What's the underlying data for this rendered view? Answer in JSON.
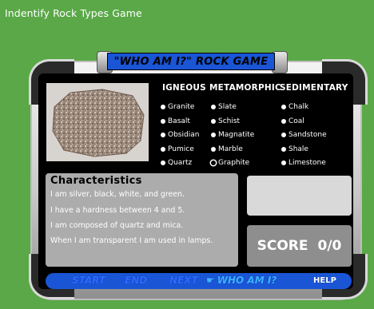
{
  "page": {
    "title": "Indentify Rock Types Game"
  },
  "game": {
    "title": "\"WHO AM I?\" ROCK GAME",
    "categories": [
      {
        "name": "IGNEOUS",
        "options": [
          "Granite",
          "Basalt",
          "Obsidian",
          "Pumice",
          "Quartz"
        ]
      },
      {
        "name": "METAMORPHIC",
        "options": [
          "Slate",
          "Schist",
          "Magnatite",
          "Marble",
          "Graphite"
        ]
      },
      {
        "name": "SEDIMENTARY",
        "options": [
          "Chalk",
          "Coal",
          "Sandstone",
          "Shale",
          "Limestone"
        ]
      }
    ],
    "selected_option": "Graphite",
    "characteristics": {
      "heading": "Characteristics",
      "lines": [
        "I am silver, black, white, and green.",
        "I have a hardness between 4 and 5.",
        "I am composed of quartz and mica.",
        "When I am transparent I am used in lamps."
      ]
    },
    "answer": "",
    "score": {
      "label": "SCORE",
      "value": "0/0"
    },
    "nav": {
      "start": "START",
      "end": "END",
      "next": "NEXT",
      "whoami": "WHO AM I?",
      "help": "HELP"
    },
    "colors": {
      "background": "#5aa847",
      "accent_blue": "#1a55d6"
    }
  }
}
